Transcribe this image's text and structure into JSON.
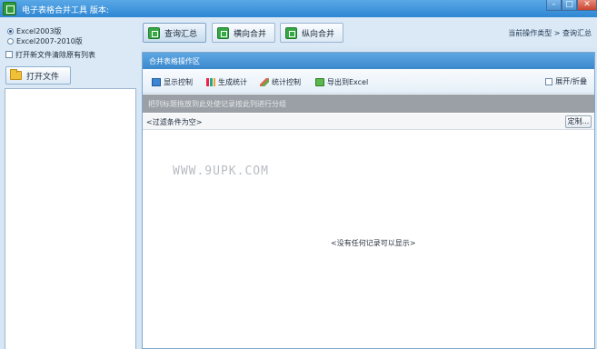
{
  "window": {
    "title": "电子表格合并工具 版本:",
    "controls": {
      "minimize": "–",
      "maximize": "□",
      "close": "✕"
    }
  },
  "left_panel": {
    "format_options": [
      {
        "label": "Excel2003版",
        "selected": true
      },
      {
        "label": "Excel2007-2010版",
        "selected": false
      }
    ],
    "clear_list_option": {
      "label": "打开新文件清除原有列表",
      "checked": false
    },
    "open_file_button": "打开文件",
    "open_file_icon": "folder-icon"
  },
  "tabs": [
    {
      "label": "查询汇总",
      "icon": "excel-icon",
      "active": true
    },
    {
      "label": "横向合并",
      "icon": "excel-icon",
      "active": false
    },
    {
      "label": "纵向合并",
      "icon": "excel-icon",
      "active": false
    }
  ],
  "breadcrumb": {
    "label": "当前操作类型",
    "separator": ">",
    "current": "查询汇总"
  },
  "panel": {
    "title": "合并表格操作区",
    "toolbar": [
      {
        "label": "显示控制",
        "icon": "monitor-icon"
      },
      {
        "label": "生成统计",
        "icon": "bar-chart-icon"
      },
      {
        "label": "统计控制",
        "icon": "pencil-icon"
      },
      {
        "label": "导出到Excel",
        "icon": "excel-export-icon"
      }
    ],
    "expand_collapse": {
      "label": "展开/折叠",
      "checked": false
    },
    "group_hint": "把列标题拖放到此处使记录按此列进行分组",
    "filter_text": "<过滤条件为空>",
    "customize_button": "定制...",
    "watermark": "WWW.9UPK.COM",
    "empty_message": "<没有任何记录可以显示>"
  },
  "colors": {
    "title_bar": "#3b8fd8",
    "panel_header": "#4a96d8",
    "group_bar": "#9aa0a6",
    "background": "#d6e6f4"
  }
}
